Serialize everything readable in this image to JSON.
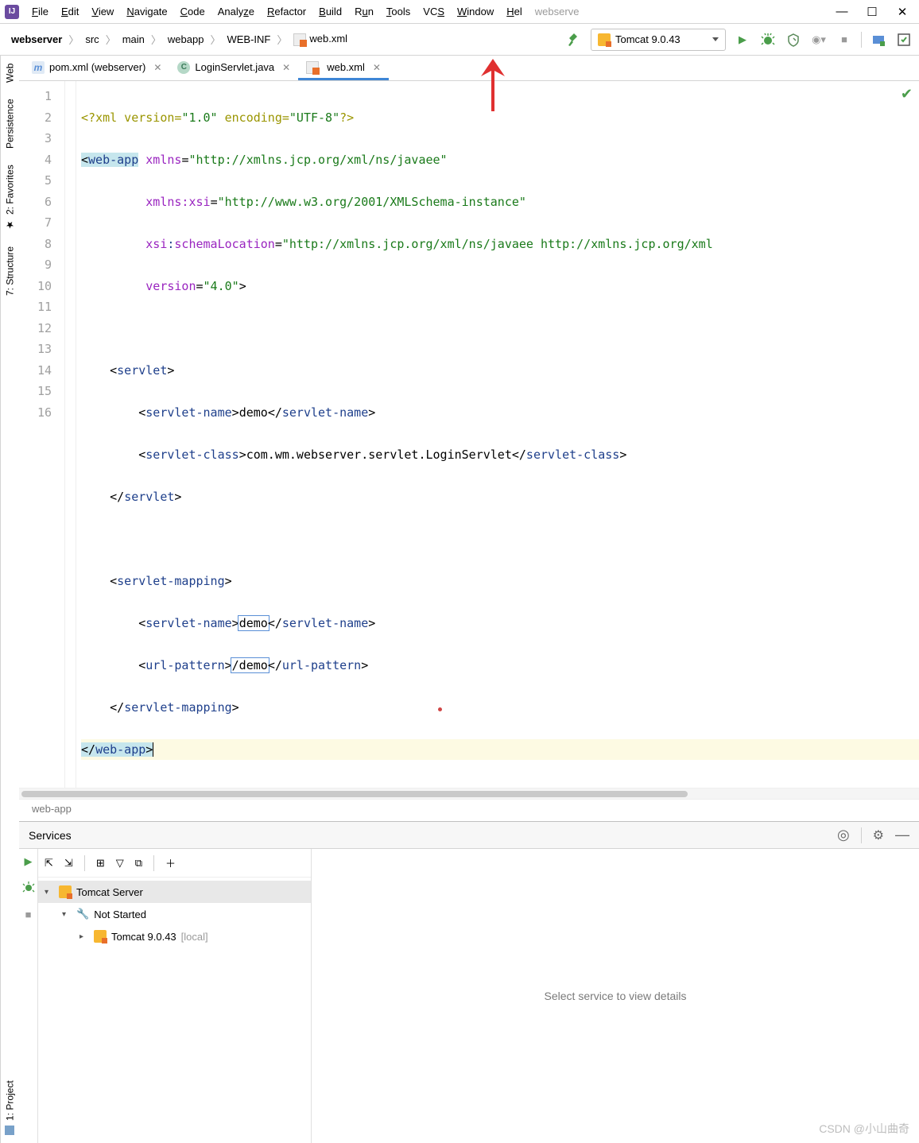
{
  "menubar": {
    "items": [
      "File",
      "Edit",
      "View",
      "Navigate",
      "Code",
      "Analyze",
      "Refactor",
      "Build",
      "Run",
      "Tools",
      "VCS",
      "Window",
      "Help"
    ],
    "title_dim": "webserve"
  },
  "breadcrumbs": [
    "webserver",
    "src",
    "main",
    "webapp",
    "WEB-INF",
    "web.xml"
  ],
  "run_config": {
    "label": "Tomcat 9.0.43"
  },
  "tabs": [
    {
      "label": "pom.xml (webserver)",
      "icon": "m",
      "active": false
    },
    {
      "label": "LoginServlet.java",
      "icon": "c",
      "active": false
    },
    {
      "label": "web.xml",
      "icon": "xml",
      "active": true
    }
  ],
  "line_numbers": [
    "1",
    "2",
    "3",
    "4",
    "5",
    "6",
    "7",
    "8",
    "9",
    "10",
    "11",
    "12",
    "13",
    "14",
    "15",
    "16"
  ],
  "code": {
    "l1": {
      "a": "<?",
      "b": "xml version",
      "c": "=",
      "d": "\"1.0\"",
      "e": " encoding",
      "f": "=",
      "g": "\"UTF-8\"",
      "h": "?>"
    },
    "l2": {
      "a": "<",
      "b": "web-app",
      "sp": " ",
      "c": "xmlns",
      "d": "=",
      "e": "\"http://xmlns.jcp.org/xml/ns/javaee\""
    },
    "l3": {
      "pad": "         ",
      "a": "xmlns:xsi",
      "b": "=",
      "c": "\"http://www.w3.org/2001/XMLSchema-instance\""
    },
    "l4": {
      "pad": "         ",
      "a": "xsi",
      "b": ":",
      "c": "schemaLocation",
      "d": "=",
      "e": "\"http://xmlns.jcp.org/xml/ns/javaee http://xmlns.jcp.org/xml"
    },
    "l5": {
      "pad": "         ",
      "a": "version",
      "b": "=",
      "c": "\"4.0\"",
      "d": ">"
    },
    "l7": {
      "pad": "    ",
      "a": "<",
      "b": "servlet",
      "c": ">"
    },
    "l8": {
      "pad": "        ",
      "a": "<",
      "b": "servlet-name",
      "c": ">",
      "d": "demo",
      "e": "</",
      "f": "servlet-name",
      "g": ">"
    },
    "l9": {
      "pad": "        ",
      "a": "<",
      "b": "servlet-class",
      "c": ">",
      "d": "com.wm.webserver.servlet.LoginServlet",
      "e": "</",
      "f": "servlet-class",
      "g": ">"
    },
    "l10": {
      "pad": "    ",
      "a": "</",
      "b": "servlet",
      "c": ">"
    },
    "l12": {
      "pad": "    ",
      "a": "<",
      "b": "servlet-mapping",
      "c": ">"
    },
    "l13": {
      "pad": "        ",
      "a": "<",
      "b": "servlet-name",
      "c": ">",
      "d": "demo",
      "e": "</",
      "f": "servlet-name",
      "g": ">"
    },
    "l14": {
      "pad": "        ",
      "a": "<",
      "b": "url-pattern",
      "c": ">",
      "d": "/demo",
      "e": "</",
      "f": "url-pattern",
      "g": ">"
    },
    "l15": {
      "pad": "    ",
      "a": "</",
      "b": "servlet-mapping",
      "c": ">"
    },
    "l16": {
      "a": "</",
      "b": "web-app",
      "c": ">"
    }
  },
  "editor_breadcrumb": "web-app",
  "left_gutter": {
    "project": "1: Project",
    "structure": "7: Structure",
    "favorites": "2: Favorites",
    "persistence": "Persistence",
    "web": "Web"
  },
  "services": {
    "title": "Services",
    "tree": {
      "root": "Tomcat Server",
      "child": "Not Started",
      "leaf": "Tomcat 9.0.43",
      "leaf_suffix": "[local]"
    },
    "placeholder": "Select service to view details"
  },
  "watermark": "CSDN @小山曲奇"
}
